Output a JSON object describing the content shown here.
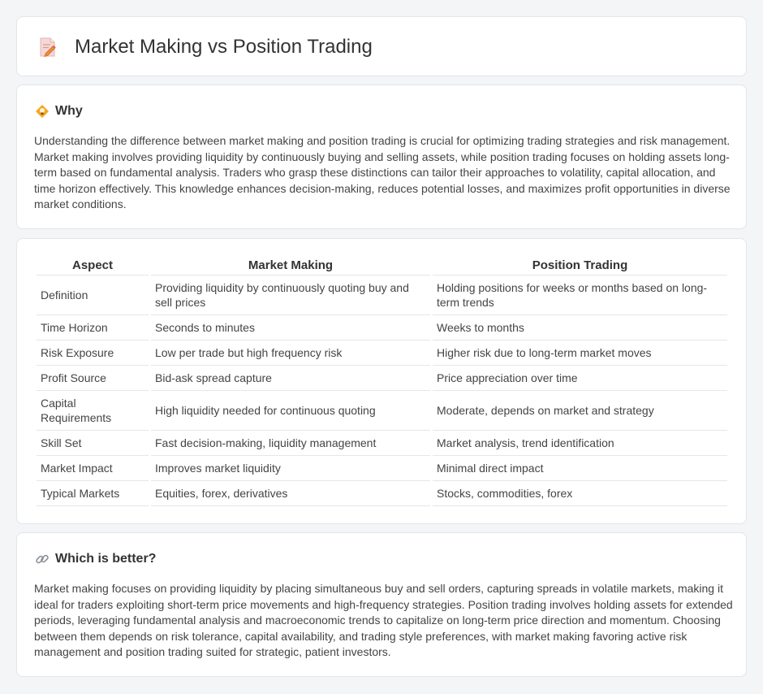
{
  "header": {
    "title": "Market Making vs Position Trading",
    "icon": "document-pencil-icon"
  },
  "why": {
    "heading": "Why",
    "icon": "lightbulb-icon",
    "body": "Understanding the difference between market making and position trading is crucial for optimizing trading strategies and risk management. Market making involves providing liquidity by continuously buying and selling assets, while position trading focuses on holding assets long-term based on fundamental analysis. Traders who grasp these distinctions can tailor their approaches to volatility, capital allocation, and time horizon effectively. This knowledge enhances decision-making, reduces potential losses, and maximizes profit opportunities in diverse market conditions."
  },
  "table": {
    "headers": [
      "Aspect",
      "Market Making",
      "Position Trading"
    ],
    "rows": [
      [
        "Definition",
        "Providing liquidity by continuously quoting buy and sell prices",
        "Holding positions for weeks or months based on long-term trends"
      ],
      [
        "Time Horizon",
        "Seconds to minutes",
        "Weeks to months"
      ],
      [
        "Risk Exposure",
        "Low per trade but high frequency risk",
        "Higher risk due to long-term market moves"
      ],
      [
        "Profit Source",
        "Bid-ask spread capture",
        "Price appreciation over time"
      ],
      [
        "Capital Requirements",
        "High liquidity needed for continuous quoting",
        "Moderate, depends on market and strategy"
      ],
      [
        "Skill Set",
        "Fast decision-making, liquidity management",
        "Market analysis, trend identification"
      ],
      [
        "Market Impact",
        "Improves market liquidity",
        "Minimal direct impact"
      ],
      [
        "Typical Markets",
        "Equities, forex, derivatives",
        "Stocks, commodities, forex"
      ]
    ]
  },
  "better": {
    "heading": "Which is better?",
    "icon": "link-icon",
    "body": "Market making focuses on providing liquidity by placing simultaneous buy and sell orders, capturing spreads in volatile markets, making it ideal for traders exploiting short-term price movements and high-frequency strategies. Position trading involves holding assets for extended periods, leveraging fundamental analysis and macroeconomic trends to capitalize on long-term price direction and momentum. Choosing between them depends on risk tolerance, capital availability, and trading style preferences, with market making favoring active risk management and position trading suited for strategic, patient investors."
  }
}
